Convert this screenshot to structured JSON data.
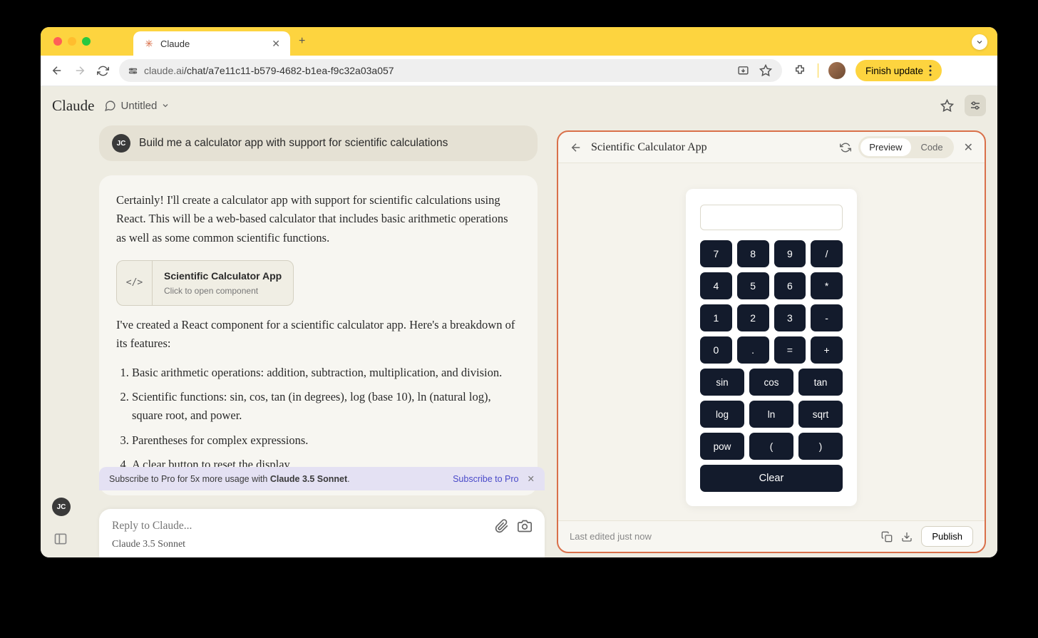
{
  "browser": {
    "tab_title": "Claude",
    "url_host": "claude.ai",
    "url_path": "/chat/a7e11c11-b579-4682-b1ea-f9c32a03a057",
    "finish_update": "Finish update"
  },
  "app": {
    "brand": "Claude",
    "chat_title": "Untitled"
  },
  "user": {
    "initials": "JC",
    "message": "Build me a calculator app with support for scientific calculations"
  },
  "assistant": {
    "intro": "Certainly! I'll create a calculator app with support for scientific calculations using React. This will be a web-based calculator that includes basic arithmetic operations as well as some common scientific functions.",
    "artifact_title": "Scientific Calculator App",
    "artifact_sub": "Click to open component",
    "artifact_icon": "</>",
    "body2": "I've created a React component for a scientific calculator app. Here's a breakdown of its features:",
    "features": [
      "Basic arithmetic operations: addition, subtraction, multiplication, and division.",
      "Scientific functions: sin, cos, tan (in degrees), log (base 10), ln (natural log), square root, and power.",
      "Parentheses for complex expressions.",
      "A clear button to reset the display."
    ]
  },
  "promo": {
    "text_a": "Subscribe to Pro for 5x more usage with ",
    "text_b": "Claude 3.5 Sonnet",
    "text_c": ".",
    "cta": "Subscribe to Pro"
  },
  "input": {
    "placeholder": "Reply to Claude...",
    "model": "Claude 3.5 Sonnet"
  },
  "artifact_panel": {
    "title": "Scientific Calculator App",
    "preview": "Preview",
    "code": "Code",
    "footer": "Last edited just now",
    "publish": "Publish"
  },
  "calculator": {
    "row1": [
      "7",
      "8",
      "9",
      "/"
    ],
    "row2": [
      "4",
      "5",
      "6",
      "*"
    ],
    "row3": [
      "1",
      "2",
      "3",
      "-"
    ],
    "row4": [
      "0",
      ".",
      "=",
      "+"
    ],
    "fns1": [
      "sin",
      "cos",
      "tan"
    ],
    "fns2": [
      "log",
      "ln",
      "sqrt"
    ],
    "fns3": [
      "pow",
      "(",
      ")"
    ],
    "clear": "Clear"
  }
}
